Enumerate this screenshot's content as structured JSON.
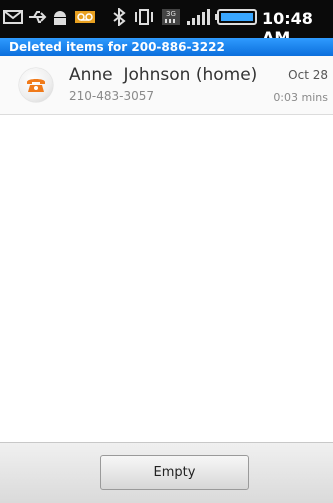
{
  "status_bar": {
    "time": "10:48 AM",
    "icons": [
      "envelope-icon",
      "usb-icon",
      "android-debug-icon",
      "voicemail-icon",
      "bluetooth-icon",
      "vibrate-icon",
      "3g-icon",
      "signal-icon",
      "battery-icon"
    ]
  },
  "title_strip": {
    "text": "Deleted items for 200-886-3222"
  },
  "list": {
    "items": [
      {
        "name": "Anne  Johnson (home)",
        "number": "210-483-3057",
        "date": "Oct 28",
        "duration": "0:03 mins"
      }
    ]
  },
  "bottom": {
    "empty_label": "Empty"
  },
  "colors": {
    "title_strip": "#1a80f0",
    "phone_icon": "#f07a1a"
  }
}
